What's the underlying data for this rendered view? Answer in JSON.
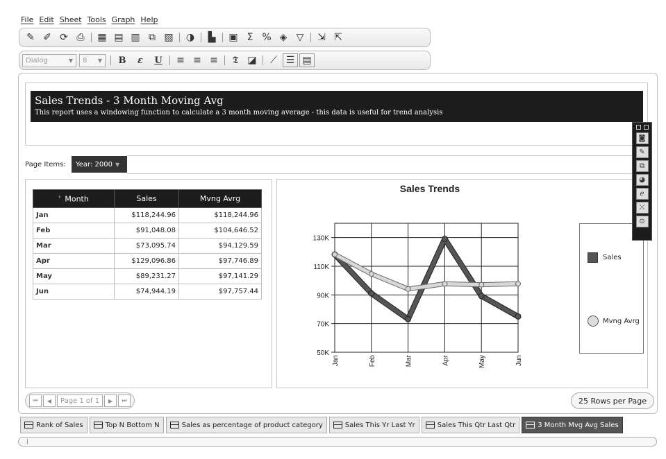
{
  "menu": [
    "File",
    "Edit",
    "Sheet",
    "Tools",
    "Graph",
    "Help"
  ],
  "format_toolbar": {
    "font_value": "Dialog",
    "size_value": "8",
    "bold": "B",
    "italic": "ɛ",
    "underline": "U"
  },
  "report": {
    "title": "Sales Trends - 3 Month Moving Avg",
    "description": "This report uses a windowing function to calculate a 3 month moving average - this data is useful for trend analysis"
  },
  "page_items": {
    "label": "Page Items:",
    "selected": "Year: 2000"
  },
  "table": {
    "columns": [
      "Month",
      "Sales",
      "Mvng Avrg"
    ],
    "rows": [
      [
        "Jan",
        "$118,244.96",
        "$118,244.96"
      ],
      [
        "Feb",
        "$91,048.08",
        "$104,646.52"
      ],
      [
        "Mar",
        "$73,095.74",
        "$94,129.59"
      ],
      [
        "Apr",
        "$129,096.86",
        "$97,746.89"
      ],
      [
        "May",
        "$89,231.27",
        "$97,141.29"
      ],
      [
        "Jun",
        "$74,944.19",
        "$97,757.44"
      ]
    ]
  },
  "chart_data": {
    "type": "line",
    "title": "Sales Trends",
    "categories": [
      "Jan",
      "Feb",
      "Mar",
      "Apr",
      "May",
      "Jun"
    ],
    "y_ticks": [
      "50K",
      "70K",
      "90K",
      "110K",
      "130K"
    ],
    "ylim": [
      50000,
      140000
    ],
    "grid": true,
    "legend_position": "right",
    "series": [
      {
        "name": "Sales",
        "color": "#555555",
        "values": [
          118244.96,
          91048.08,
          73095.74,
          129096.86,
          89231.27,
          74944.19
        ]
      },
      {
        "name": "Mvng Avrg",
        "color": "#d8d8d8",
        "values": [
          118244.96,
          104646.52,
          94129.59,
          97746.89,
          97141.29,
          97757.44
        ]
      }
    ]
  },
  "pager": {
    "page_label": "Page 1 of 1",
    "rows_per_page": "25 Rows per Page"
  },
  "tabs": [
    {
      "label": "Rank of Sales",
      "active": false
    },
    {
      "label": "Top N Bottom N",
      "active": false
    },
    {
      "label": "Sales as percentage of product category",
      "active": false
    },
    {
      "label": "Sales This Yr Last Yr",
      "active": false
    },
    {
      "label": "Sales This Qtr Last Qtr",
      "active": false
    },
    {
      "label": "3 Month Mvg Avg Sales",
      "active": true
    }
  ]
}
